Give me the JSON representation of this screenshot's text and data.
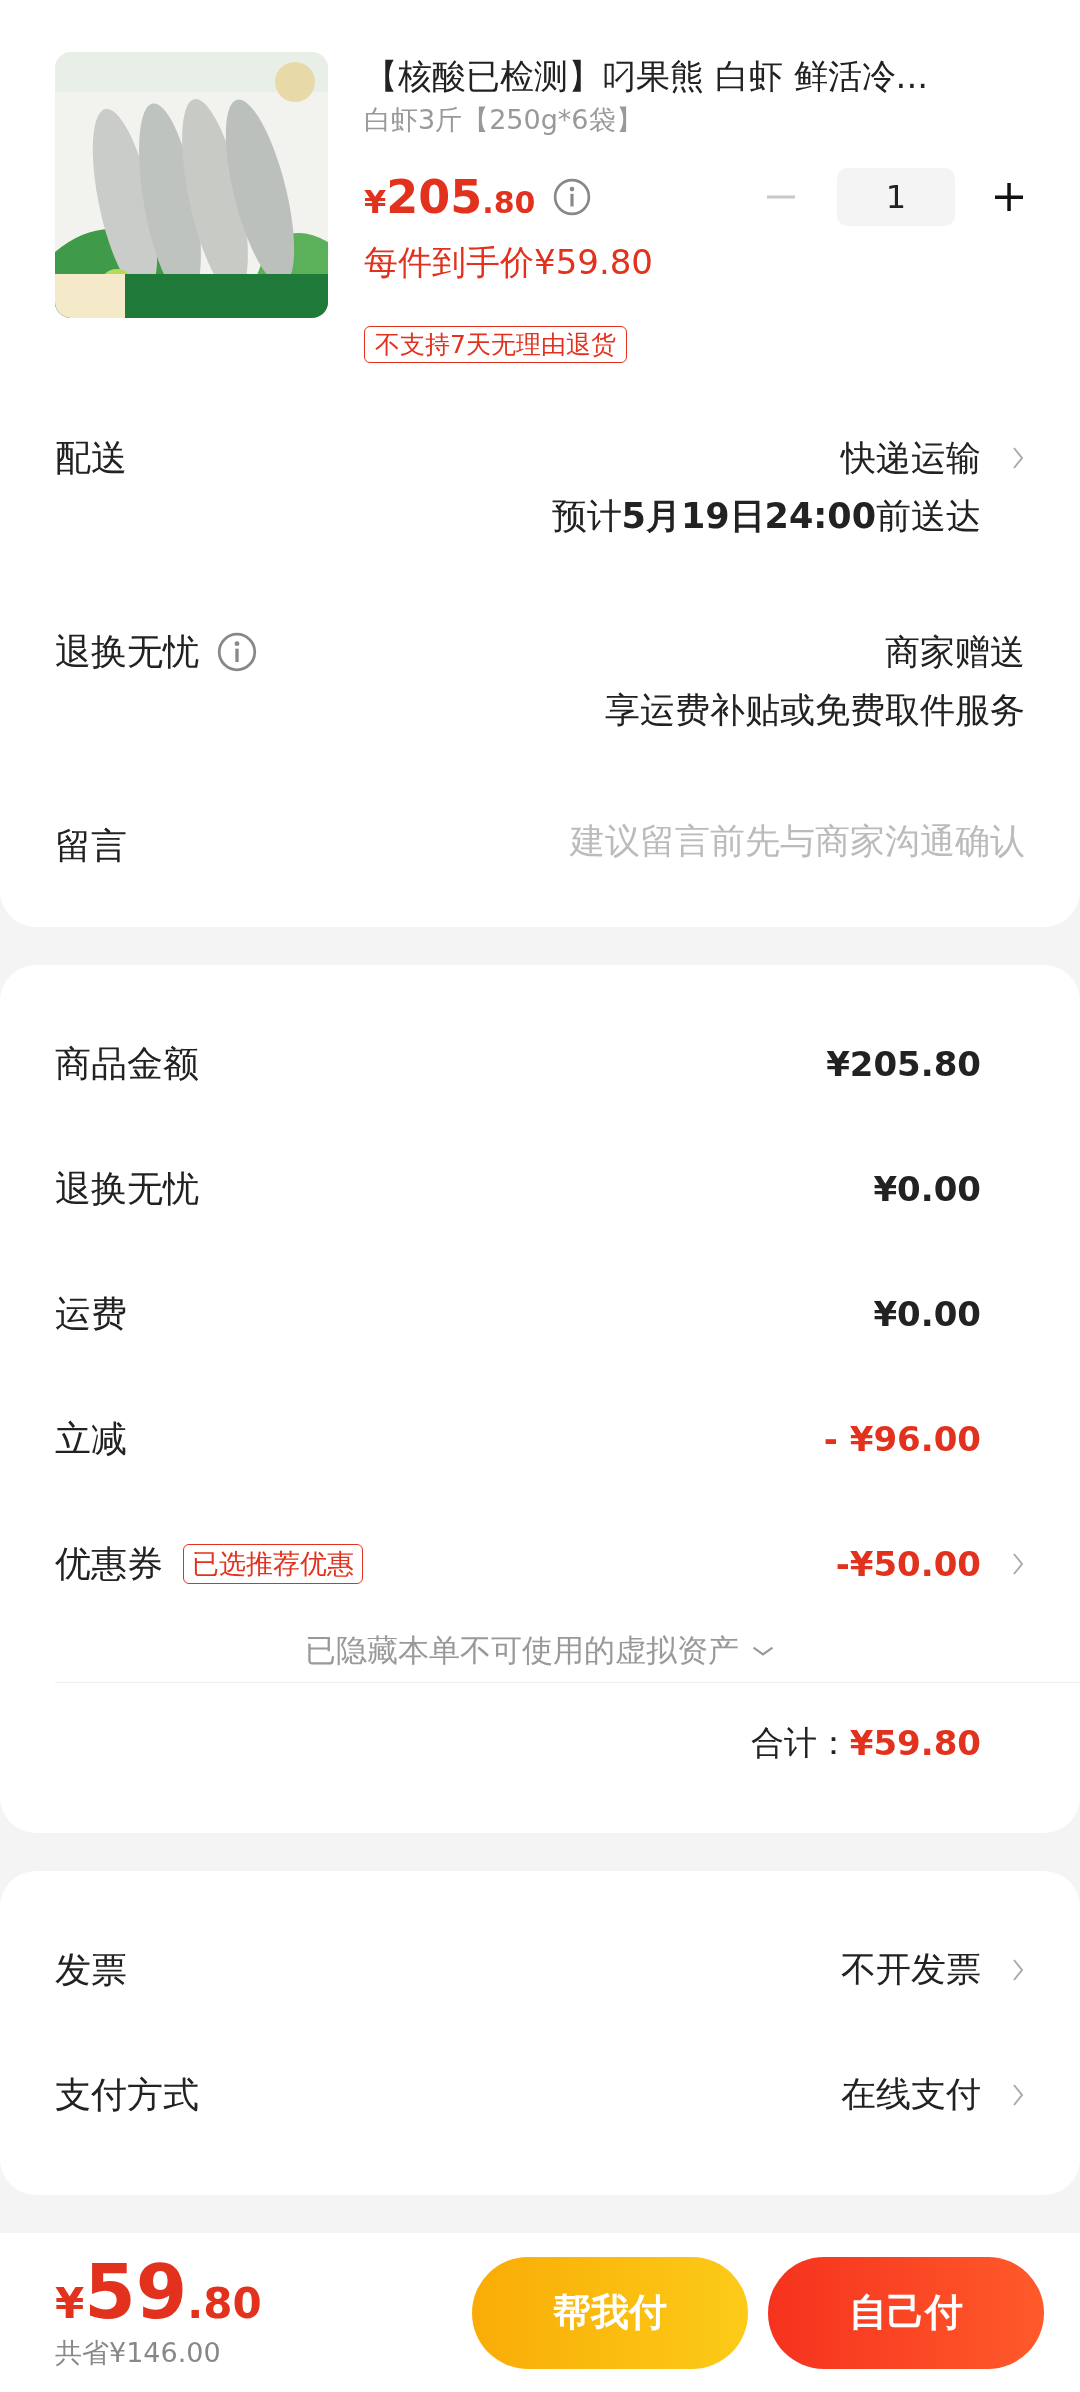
{
  "product": {
    "kind": "picture",
    "title": "【核酸已检测】叼果熊 白虾 鲜活冷...",
    "spec": "白虾3斤【250g*6袋】",
    "price": {
      "symbol": "¥",
      "integer": "205",
      "decimal": ".80"
    },
    "unit_price": "每件到手价¥59.80",
    "tag": "不支持7天无理由退货",
    "quantity": "1"
  },
  "details": [
    {
      "kind": "lines",
      "label": "配送",
      "info": false,
      "chevron": true,
      "lines": [
        "快递运输",
        "预计**5月19日24:00**前送达"
      ]
    },
    {
      "kind": "lines",
      "label": "退换无忧",
      "info": true,
      "chevron": false,
      "lines": [
        "商家赠送",
        "享运费补贴或免费取件服务"
      ]
    },
    {
      "kind": "field",
      "label": "留言",
      "info": false,
      "chevron": false,
      "placeholder": "建议留言前先与商家沟通确认"
    }
  ],
  "amounts": [
    {
      "label": "商品金额",
      "value": "¥205.80",
      "color": "#222222",
      "chevron": false
    },
    {
      "label": "退换无忧",
      "value": "¥0.00",
      "color": "#222222",
      "chevron": false
    },
    {
      "label": "运费",
      "value": "¥0.00",
      "color": "#222222",
      "chevron": false
    },
    {
      "label": "立减",
      "value": "- ¥96.00",
      "color": "#e2321d",
      "chevron": false
    },
    {
      "label": "优惠券",
      "badge": "已选推荐优惠",
      "value": "-¥50.00",
      "color": "#e2321d",
      "chevron": true
    }
  ],
  "hidden_assets": "已隐藏本单不可使用的虚拟资产",
  "total": {
    "label": "合计：",
    "value": "¥59.80"
  },
  "options": [
    {
      "label": "发票",
      "value": "不开发票",
      "chevron": true
    },
    {
      "label": "支付方式",
      "value": "在线支付",
      "chevron": true
    }
  ],
  "footer": {
    "price": {
      "symbol": "¥",
      "integer": "59",
      "decimal": ".80"
    },
    "saved": "共省¥146.00",
    "buttons": [
      {
        "kind": "secondary",
        "label": "帮我付"
      },
      {
        "kind": "primary",
        "label": "自己付"
      }
    ]
  }
}
